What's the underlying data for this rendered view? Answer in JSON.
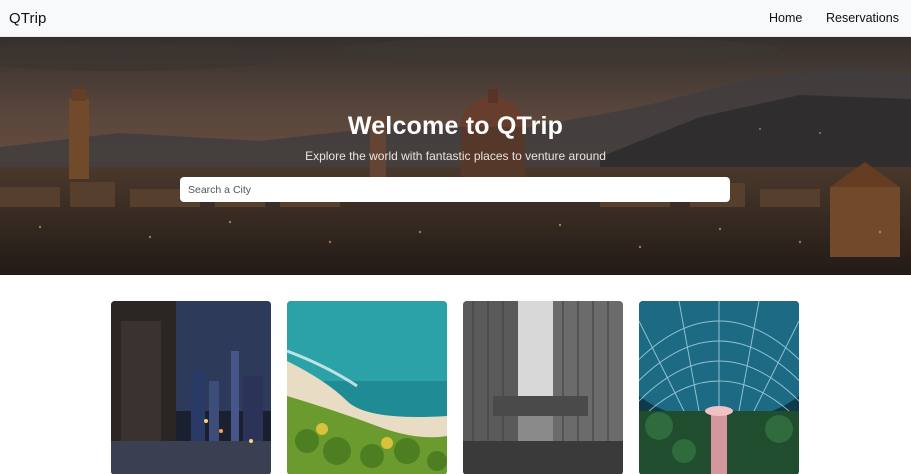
{
  "navbar": {
    "brand": "QTrip",
    "links": [
      {
        "label": "Home"
      },
      {
        "label": "Reservations"
      }
    ]
  },
  "hero": {
    "title": "Welcome to QTrip",
    "subtitle": "Explore the world with fantastic places to venture around",
    "search": {
      "placeholder": "Search a City",
      "value": ""
    }
  },
  "cities": [
    {
      "image": "night-city-street-photo"
    },
    {
      "image": "aerial-beach-photo"
    },
    {
      "image": "office-towers-bw-photo"
    },
    {
      "image": "glass-dome-waterfall-photo"
    }
  ],
  "colors": {
    "navbar_bg": "#f8f9fa",
    "hero_overlay": "#4b3a31",
    "text_dark": "#111111",
    "white": "#ffffff"
  }
}
